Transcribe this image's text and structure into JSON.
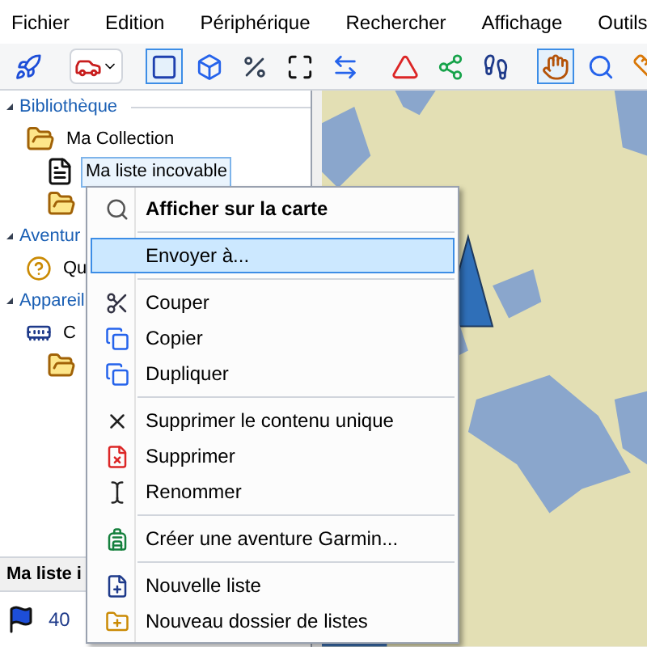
{
  "menu_bar": [
    "Fichier",
    "Edition",
    "Périphérique",
    "Rechercher",
    "Affichage",
    "Outils"
  ],
  "toolbar": [
    {
      "selected": false
    },
    {
      "selected": false
    },
    {
      "selected": true
    },
    {
      "selected": false
    },
    {
      "selected": false
    },
    {
      "selected": false
    },
    {
      "selected": false
    },
    {
      "selected": false
    },
    {
      "selected": false
    },
    {
      "selected": false
    },
    {
      "selected": true
    },
    {
      "selected": false
    },
    {
      "selected": false
    }
  ],
  "tree": [
    {
      "label": "Bibliothèque",
      "kind": "section",
      "expanded": true,
      "children": [
        {
          "label": "Ma Collection",
          "kind": "folder",
          "children": [
            {
              "label": "Ma liste incovable",
              "kind": "list",
              "selected": true
            },
            {
              "kind": "folder",
              "selected": false
            }
          ]
        }
      ]
    },
    {
      "label": "Aventur",
      "kind": "section",
      "expanded": true,
      "children": [
        {
          "label": "Qu",
          "kind": "question",
          "selected": false
        }
      ]
    },
    {
      "label": "Appareil",
      "kind": "section",
      "expanded": true,
      "children": [
        {
          "label": "C",
          "kind": "card",
          "children": [
            {
              "kind": "folder",
              "selected": false
            }
          ]
        }
      ]
    }
  ],
  "bottom_panel": {
    "title": "Ma liste i",
    "rows": [
      {
        "value": "40"
      }
    ]
  },
  "context_menu": [
    {
      "kind": "item",
      "label": "Afficher sur la carte",
      "bold": true,
      "selected": false
    },
    {
      "kind": "separator"
    },
    {
      "kind": "item",
      "label": "Envoyer à...",
      "bold": false,
      "selected": true
    },
    {
      "kind": "separator"
    },
    {
      "kind": "item",
      "label": "Couper",
      "bold": false,
      "selected": false
    },
    {
      "kind": "item",
      "label": "Copier",
      "bold": false,
      "selected": false
    },
    {
      "kind": "item",
      "label": "Dupliquer",
      "bold": false,
      "selected": false
    },
    {
      "kind": "separator"
    },
    {
      "kind": "item",
      "label": "Supprimer le contenu unique",
      "bold": false,
      "selected": false
    },
    {
      "kind": "item",
      "label": "Supprimer",
      "bold": false,
      "selected": false
    },
    {
      "kind": "item",
      "label": "Renommer",
      "bold": false,
      "selected": false
    },
    {
      "kind": "separator"
    },
    {
      "kind": "item",
      "label": "Créer une aventure Garmin...",
      "bold": false,
      "selected": false
    },
    {
      "kind": "separator"
    },
    {
      "kind": "item",
      "label": "Nouvelle liste",
      "bold": false,
      "selected": false
    },
    {
      "kind": "item",
      "label": "Nouveau dossier de listes",
      "bold": false,
      "selected": false
    }
  ]
}
